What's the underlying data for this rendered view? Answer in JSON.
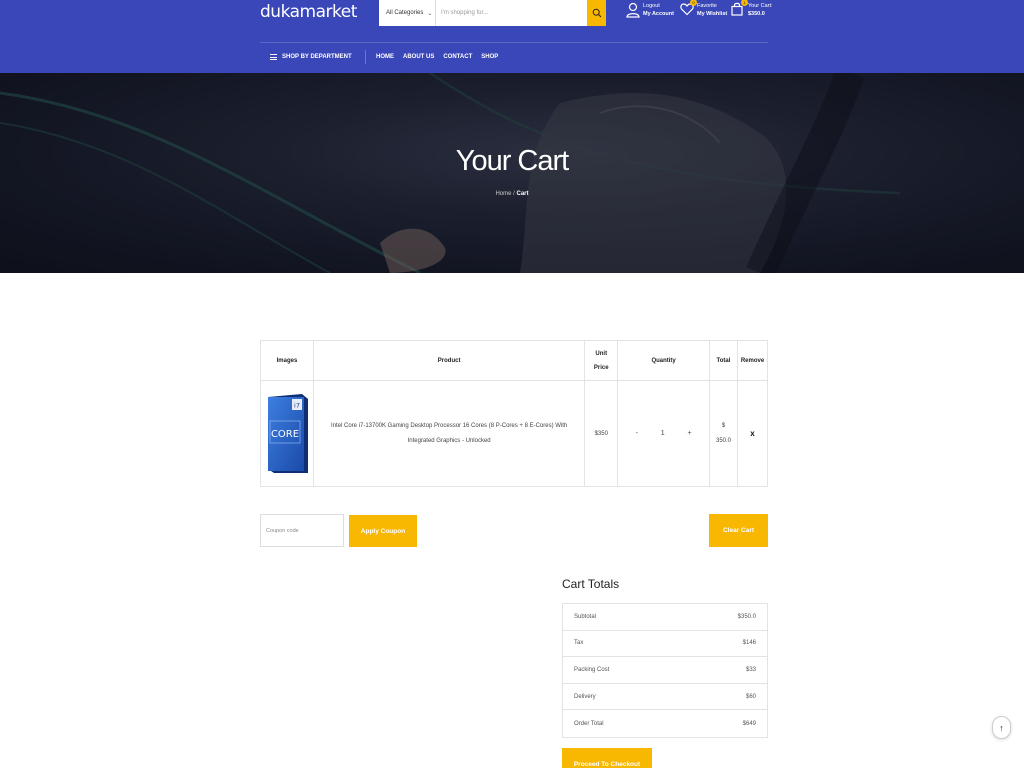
{
  "header": {
    "logo": "dukamarket",
    "search": {
      "category": "All Categories",
      "placeholder": "I'm shopping for..."
    },
    "account": {
      "line1": "Logout",
      "line2": "My Account"
    },
    "wishlist": {
      "line1": "Favorite",
      "line2": "My Wishlist",
      "count": "0"
    },
    "cart": {
      "line1": "Your Cart:",
      "line2": "$350.0",
      "count": "1"
    },
    "department_label": "SHOP BY DEPARTMENT",
    "nav": [
      "HOME",
      "ABOUT US",
      "CONTACT",
      "SHOP"
    ]
  },
  "hero": {
    "title": "Your Cart",
    "breadcrumb": {
      "home": "Home",
      "sep": "/",
      "current": "Cart"
    }
  },
  "cart": {
    "columns": {
      "images": "Images",
      "product": "Product",
      "unit_price_1": "Unit",
      "unit_price_2": "Price",
      "quantity": "Quantity",
      "total": "Total",
      "remove": "Remove"
    },
    "items": [
      {
        "image_label": "CORE",
        "image_badge": "i7",
        "product": "Intel Core i7-13700K Gaming Desktop Processor 16 Cores (8 P-Cores + 8 E-Cores) With Integrated Graphics - Unlocked",
        "unit_price": "$350",
        "qty_minus": "-",
        "quantity": "1",
        "qty_plus": "+",
        "total_1": "$",
        "total_2": "350.0",
        "remove": "x"
      }
    ]
  },
  "coupon": {
    "placeholder": "Coupon code",
    "apply_label": "Apply Coupon",
    "clear_label": "Clear Cart"
  },
  "totals": {
    "title": "Cart Totals",
    "rows": [
      {
        "label": "Subtotal",
        "value": "$350.0"
      },
      {
        "label": "Tax",
        "value": "$146"
      },
      {
        "label": "Packing Cost",
        "value": "$33"
      },
      {
        "label": "Delivery",
        "value": "$60"
      },
      {
        "label": "Order Total",
        "value": "$649"
      }
    ],
    "checkout_label": "Proceed To Checkout"
  },
  "scroll_top": "↑",
  "colors": {
    "header_bg": "#3a47b8",
    "accent": "#f8b700"
  }
}
